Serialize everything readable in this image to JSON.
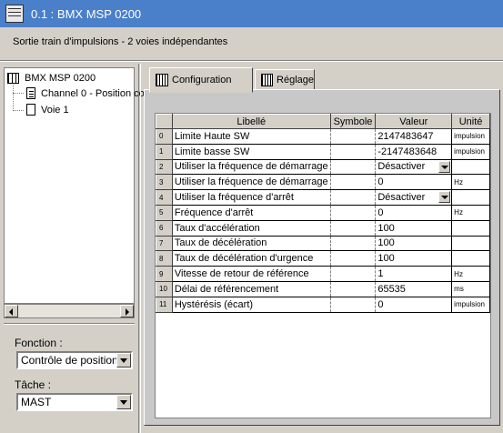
{
  "window": {
    "title": "0.1 : BMX MSP 0200"
  },
  "subtitle": "Sortie train d'impulsions - 2 voies indépendantes",
  "tree": {
    "root": "BMX MSP 0200",
    "items": [
      "Channel 0 - Position co",
      "Voie 1"
    ]
  },
  "fonction": {
    "label": "Fonction :",
    "value": "Contrôle de position"
  },
  "tache": {
    "label": "Tâche :",
    "value": "MAST"
  },
  "tabs": [
    {
      "label": "Configuration",
      "active": true
    },
    {
      "label": "Réglage",
      "active": false
    }
  ],
  "table": {
    "headers": [
      "Libellé",
      "Symbole",
      "Valeur",
      "Unité"
    ],
    "rows": [
      {
        "num": "0",
        "label": "Limite Haute SW",
        "value": "2147483647",
        "unit": "impulsion",
        "dropdown": false
      },
      {
        "num": "1",
        "label": "Limite basse SW",
        "value": "-2147483648",
        "unit": "impulsion",
        "dropdown": false
      },
      {
        "num": "2",
        "label": "Utiliser la fréquence de démarrage",
        "value": "Désactiver",
        "unit": "",
        "dropdown": true
      },
      {
        "num": "3",
        "label": "Utiliser la fréquence de démarrage",
        "value": "0",
        "unit": "Hz",
        "dropdown": false
      },
      {
        "num": "4",
        "label": "Utiliser la fréquence d'arrêt",
        "value": "Désactiver",
        "unit": "",
        "dropdown": true
      },
      {
        "num": "5",
        "label": "Fréquence d'arrêt",
        "value": "0",
        "unit": "Hz",
        "dropdown": false
      },
      {
        "num": "6",
        "label": "Taux d'accélération",
        "value": "100",
        "unit": "",
        "dropdown": false
      },
      {
        "num": "7",
        "label": "Taux de décélération",
        "value": "100",
        "unit": "",
        "dropdown": false
      },
      {
        "num": "8",
        "label": "Taux de décélération d'urgence",
        "value": "100",
        "unit": "",
        "dropdown": false
      },
      {
        "num": "9",
        "label": "Vitesse de retour de référence",
        "value": "1",
        "unit": "Hz",
        "dropdown": false
      },
      {
        "num": "10",
        "label": "Délai de référencement",
        "value": "65535",
        "unit": "ms",
        "dropdown": false
      },
      {
        "num": "11",
        "label": "Hystérésis (écart)",
        "value": "0",
        "unit": "impulsion",
        "dropdown": false
      }
    ]
  },
  "colors": {
    "titlebar": "#4a7fc9",
    "face": "#d4d0c8",
    "panel": "#c8c8c8"
  }
}
